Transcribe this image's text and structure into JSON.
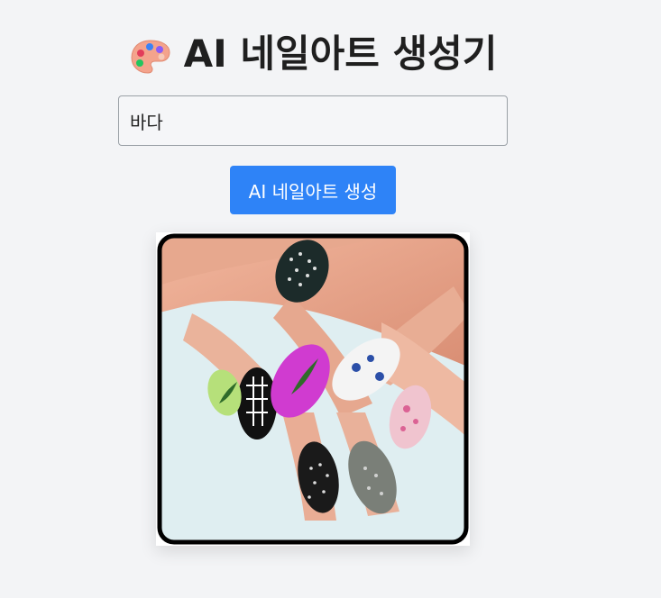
{
  "header": {
    "title": "AI 네일아트 생성기",
    "icon": "palette-icon"
  },
  "prompt": {
    "value": "바다",
    "placeholder": ""
  },
  "generate_button": {
    "label": "AI 네일아트 생성",
    "color": "#2e83f7"
  },
  "result": {
    "alt": "",
    "icon": "nail-art-image"
  },
  "colors": {
    "background": "#f3f4f6",
    "accent": "#2e83f7",
    "title": "#1f1f1f"
  }
}
